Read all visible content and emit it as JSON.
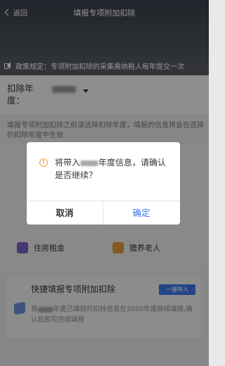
{
  "header": {
    "back_label": "返回",
    "title": "填报专项附加扣除",
    "policy_text": "政策规定：专项附加扣除的采集需纳税人每年提交一次"
  },
  "year_row": {
    "label": "扣除年度："
  },
  "tip": "填报专项附加扣除之前请选择扣除年度，填报的信息将会在选择的扣除年度中生效",
  "categories": [
    {
      "label": "住房租金",
      "icon": "house-icon",
      "color": "#7a5fc4"
    },
    {
      "label": "赡养老人",
      "icon": "elder-icon",
      "color": "#e09a3a"
    }
  ],
  "quick": {
    "title": "快捷填报专项附加扣除",
    "button_label": "一键带入",
    "desc_prefix": "将",
    "desc_rest": "年度已填报的扣除信息在2020年度继续填报,确认后即可完成填报"
  },
  "dialog": {
    "msg_prefix": "将带入",
    "msg_rest": "年度信息，请确认是否继续？",
    "cancel_label": "取消",
    "ok_label": "确定"
  },
  "colors": {
    "accent": "#3d78e8",
    "warning": "#f2a53a"
  }
}
